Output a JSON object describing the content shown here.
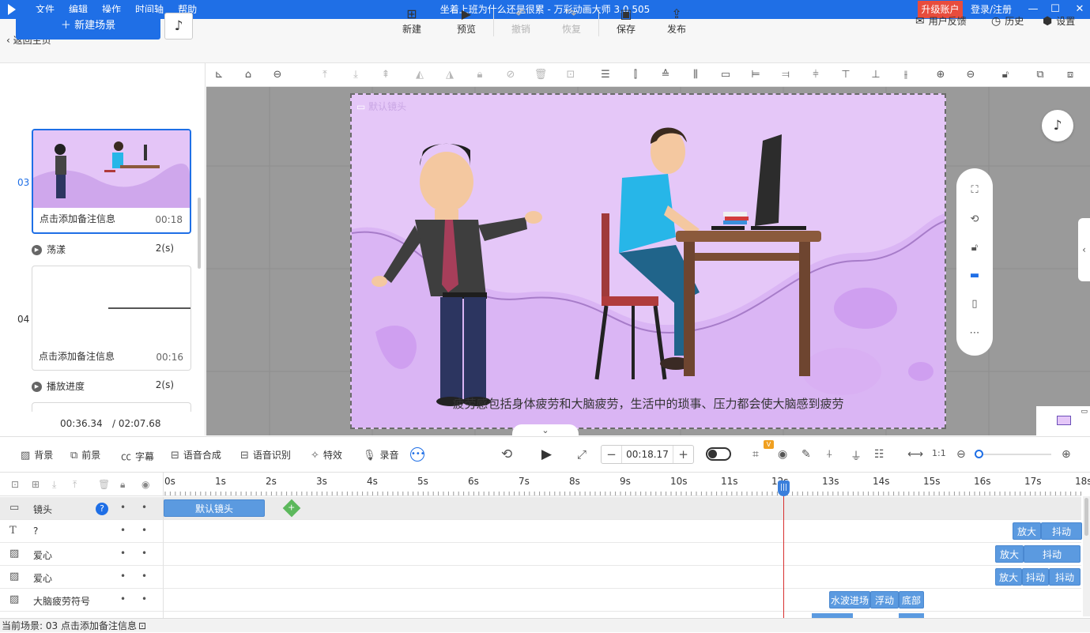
{
  "titlebar": {
    "title": "坐着上班为什么还是很累 - 万彩动画大师 3.0.505",
    "menu": [
      "文件",
      "编辑",
      "操作",
      "时间轴",
      "帮助"
    ],
    "upgrade": "升级账户",
    "login": "登录/注册"
  },
  "toolbar": {
    "back": "返回主页",
    "buttons": [
      {
        "label": "新建",
        "icon": "plus-square-icon"
      },
      {
        "label": "预览",
        "icon": "play-icon"
      },
      {
        "label": "撤销",
        "icon": "undo-icon"
      },
      {
        "label": "恢复",
        "icon": "redo-icon"
      },
      {
        "label": "保存",
        "icon": "save-icon"
      },
      {
        "label": "发布",
        "icon": "publish-icon"
      }
    ],
    "right": [
      {
        "label": "用户反馈",
        "icon": "feedback-icon"
      },
      {
        "label": "历史",
        "icon": "history-icon"
      },
      {
        "label": "设置",
        "icon": "settings-icon"
      }
    ]
  },
  "scenes": {
    "new_scene": "新建场景",
    "items": [
      {
        "num": "03",
        "note": "点击添加备注信息",
        "time": "00:18"
      },
      {
        "num": "04",
        "note": "点击添加备注信息",
        "time": "00:16"
      }
    ],
    "transitions": [
      {
        "name": "荡漾",
        "dur": "2(s)"
      },
      {
        "name": "播放进度",
        "dur": "2(s)"
      }
    ],
    "current_time": "00:36.34",
    "total_time": "/ 02:07.68"
  },
  "canvas": {
    "camera_label": "默认镜头",
    "subtitle": "疲劳感包括身体疲劳和大脑疲劳，生活中的琐事、压力都会使大脑感到疲劳"
  },
  "bottom_toolbar": {
    "items": [
      "背景",
      "前景",
      "字幕",
      "语音合成",
      "语音识别",
      "特效",
      "录音"
    ],
    "time_value": "00:18.17",
    "vip": "V"
  },
  "timeline": {
    "ticks": [
      "0s",
      "1s",
      "2s",
      "3s",
      "4s",
      "5s",
      "6s",
      "7s",
      "8s",
      "9s",
      "10s",
      "11s",
      "12s",
      "13s",
      "14s",
      "15s",
      "16s",
      "17s",
      "18s"
    ],
    "tracks": [
      {
        "name": "镜头",
        "icon": "camera-icon"
      },
      {
        "name": "?",
        "icon": "text-icon"
      },
      {
        "name": "爱心",
        "icon": "image-icon"
      },
      {
        "name": "爱心",
        "icon": "image-icon"
      },
      {
        "name": "大脑疲劳符号",
        "icon": "image-icon"
      }
    ],
    "blocks": {
      "camera": "默认镜头",
      "t1": [
        "放大",
        "抖动"
      ],
      "t2": [
        "放大",
        "抖动"
      ],
      "t3": [
        "放大",
        "抖动",
        "抖动"
      ],
      "t4": [
        "水波进场",
        "浮动",
        "底部"
      ]
    }
  },
  "status": {
    "text": "当前场景: 03    点击添加备注信息"
  }
}
